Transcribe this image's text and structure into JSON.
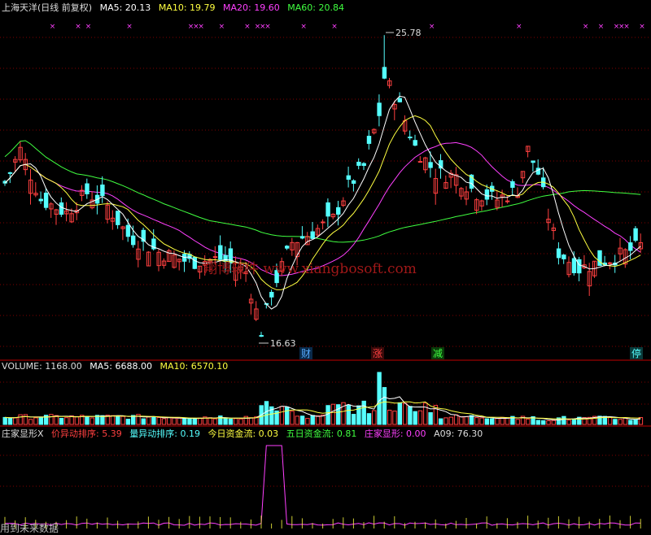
{
  "colors": {
    "up": "#ff4040",
    "down": "#55ffff",
    "ma5": "#ffffff",
    "ma10": "#ffff40",
    "ma20": "#ff40ff",
    "ma60": "#40ff40",
    "bg": "#000000",
    "grid": "#800000",
    "axis": "#c00000",
    "signal": "#ff40ff"
  },
  "header_price": {
    "stock": "上海天洋(日线 前复权)",
    "ma5": "MA5: 20.13",
    "ma10": "MA10: 19.79",
    "ma20": "MA20: 19.60",
    "ma60": "MA60: 20.84"
  },
  "header_volume": {
    "volume": "VOLUME: 1168.00",
    "ma5": "MA5: 6688.00",
    "ma10": "MA10: 6570.10"
  },
  "header_indicator": {
    "name": "庄家显形X",
    "price_anomaly": "价异动排序: 5.39",
    "volume_anomaly": "量异动排序: 0.19",
    "today_flow": "今日资金流: 0.03",
    "five_day_flow": "五日资金流: 0.81",
    "dealer": "庄家显形: 0.00",
    "a09": "A09: 76.30"
  },
  "annotations": {
    "high": "25.78",
    "low": "16.63",
    "watermark": "翔博软件 www.xiangbosoft.com",
    "note": "用到未来数据"
  },
  "event_markers": [
    {
      "label": "财",
      "color": "#55aaff"
    },
    {
      "label": "涨",
      "color": "#ff4040"
    },
    {
      "label": "减",
      "color": "#40ff40"
    },
    {
      "label": "停",
      "color": "#55ffff"
    }
  ],
  "chart_data": {
    "type": "candlestick",
    "bars": 125,
    "ylim": [
      16.0,
      26.5
    ],
    "key_points": [
      {
        "label": "high",
        "bar": 74,
        "value": 25.78
      },
      {
        "label": "low",
        "bar": 50,
        "value": 16.63
      }
    ],
    "last": {
      "ma5": 20.13,
      "ma10": 19.79,
      "ma20": 19.6,
      "ma60": 20.84,
      "volume": 1168.0,
      "vol_ma5": 6688.0,
      "vol_ma10": 6570.1
    },
    "indicator": {
      "price_anomaly": 5.39,
      "volume_anomaly": 0.19,
      "today_flow": 0.03,
      "five_day_flow": 0.81,
      "dealer": 0.0,
      "a09": 76.3
    }
  }
}
